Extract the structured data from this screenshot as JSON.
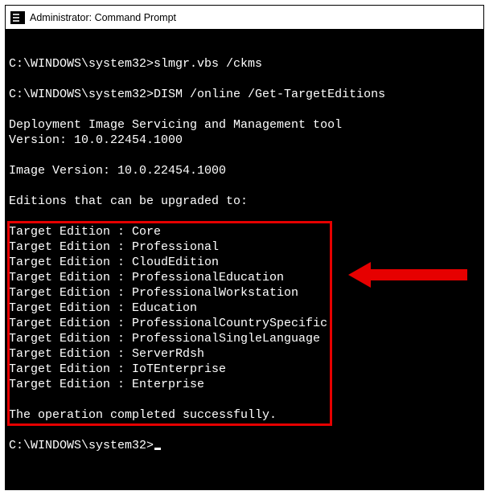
{
  "window": {
    "title": "Administrator: Command Prompt"
  },
  "console": {
    "prompt": "C:\\WINDOWS\\system32>",
    "cmd1": "slmgr.vbs /ckms",
    "cmd2": "DISM /online /Get-TargetEditions",
    "dism_header": "Deployment Image Servicing and Management tool",
    "version_line": "Version: 10.0.22454.1000",
    "image_version_line": "Image Version: 10.0.22454.1000",
    "editions_header": "Editions that can be upgraded to:",
    "target_label": "Target Edition : ",
    "editions": [
      "Core",
      "Professional",
      "CloudEdition",
      "ProfessionalEducation",
      "ProfessionalWorkstation",
      "Education",
      "ProfessionalCountrySpecific",
      "ProfessionalSingleLanguage",
      "ServerRdsh",
      "IoTEnterprise",
      "Enterprise"
    ],
    "success_line": "The operation completed successfully."
  },
  "annotation": {
    "highlight_color": "#e60000"
  }
}
